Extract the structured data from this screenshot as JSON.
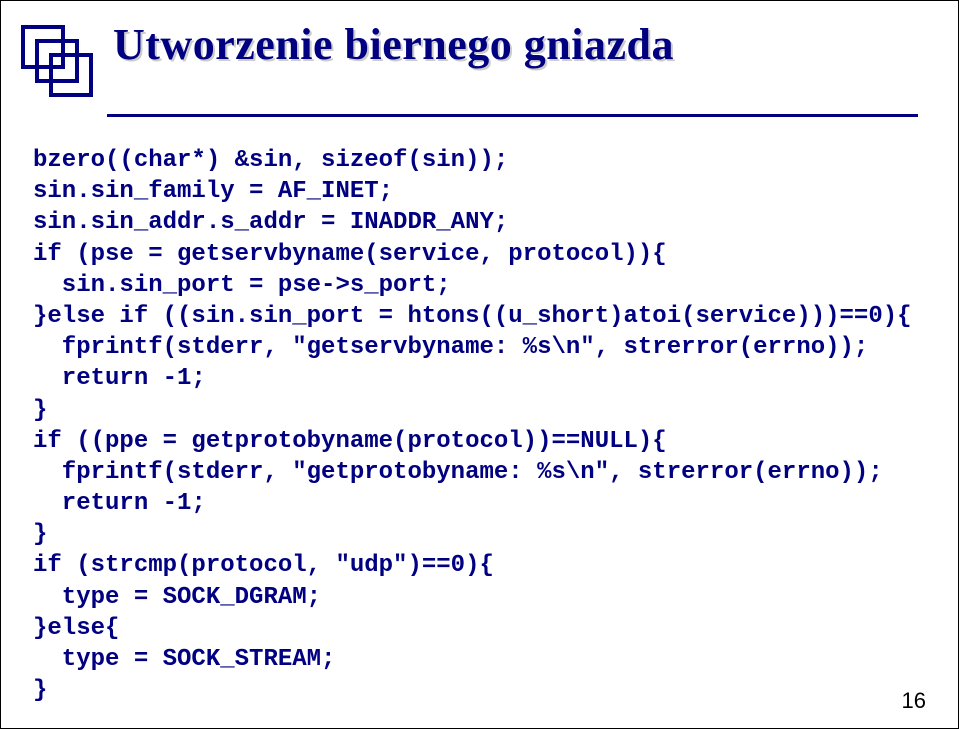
{
  "title": "Utworzenie biernego gniazda",
  "code_lines": [
    "bzero((char*) &sin, sizeof(sin));",
    "sin.sin_family = AF_INET;",
    "sin.sin_addr.s_addr = INADDR_ANY;",
    "if (pse = getservbyname(service, protocol)){",
    "  sin.sin_port = pse->s_port;",
    "}else if ((sin.sin_port = htons((u_short)atoi(service)))==0){",
    "  fprintf(stderr, \"getservbyname: %s\\n\", strerror(errno));",
    "  return -1;",
    "}",
    "if ((ppe = getprotobyname(protocol))==NULL){",
    "  fprintf(stderr, \"getprotobyname: %s\\n\", strerror(errno));",
    "  return -1;",
    "}",
    "if (strcmp(protocol, \"udp\")==0){",
    "  type = SOCK_DGRAM;",
    "}else{",
    "  type = SOCK_STREAM;",
    "}"
  ],
  "page_number": "16"
}
